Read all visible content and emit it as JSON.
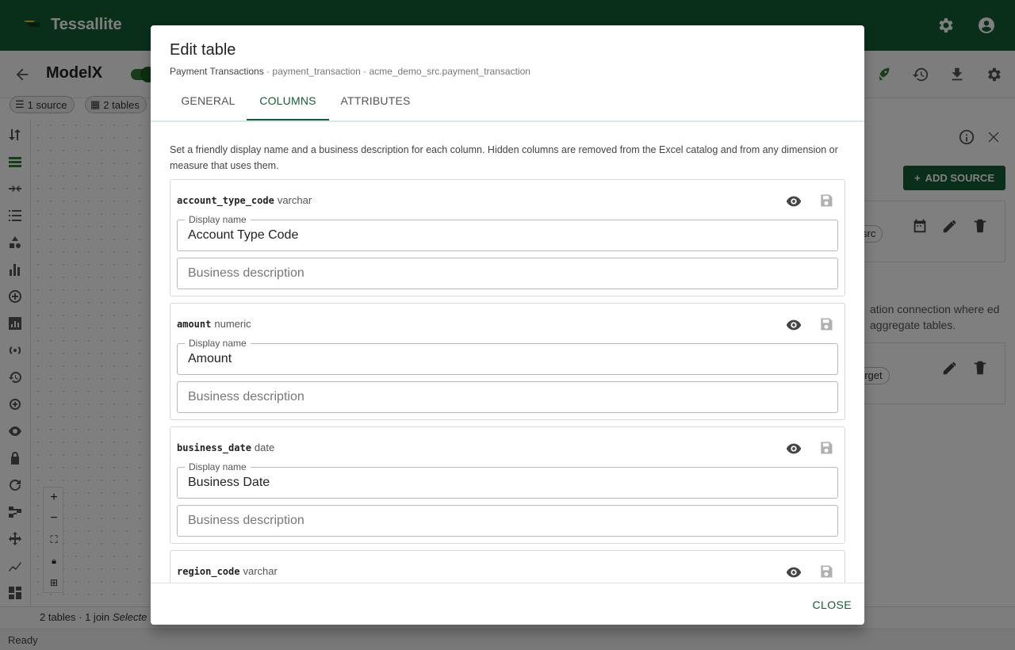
{
  "app": {
    "title": "Tessallite"
  },
  "toolbar": {
    "model_name": "ModelX"
  },
  "chips": {
    "sources": "1 source",
    "tables": "2 tables"
  },
  "right_panel": {
    "add_source_label": "ADD SOURCE",
    "chip_src": "src",
    "info_text": "ation connection where ed aggregate tables.",
    "chip_target": "arget"
  },
  "footer": {
    "summary": "2 tables · 1 join",
    "selected": "Selecte"
  },
  "status": {
    "text": "Ready"
  },
  "dialog": {
    "title": "Edit table",
    "subtitle_name": "Payment Transactions",
    "subtitle_table": "· payment_transaction",
    "subtitle_path": "· acme_demo_src.payment_transaction",
    "tabs": [
      {
        "label": "GENERAL"
      },
      {
        "label": "COLUMNS"
      },
      {
        "label": "ATTRIBUTES"
      }
    ],
    "intro": "Set a friendly display name and a business description for each column. Hidden columns are removed from the Excel catalog and from any dimension or measure that uses them.",
    "display_name_label": "Display name",
    "description_placeholder": "Business description",
    "columns": [
      {
        "name": "account_type_code",
        "type": "varchar",
        "display_name": "Account Type Code"
      },
      {
        "name": "amount",
        "type": "numeric",
        "display_name": "Amount"
      },
      {
        "name": "business_date",
        "type": "date",
        "display_name": "Business Date"
      },
      {
        "name": "region_code",
        "type": "varchar",
        "display_name": ""
      }
    ],
    "close_label": "CLOSE"
  },
  "colors": {
    "brand": "#135e34",
    "accent": "#2e7d32"
  }
}
